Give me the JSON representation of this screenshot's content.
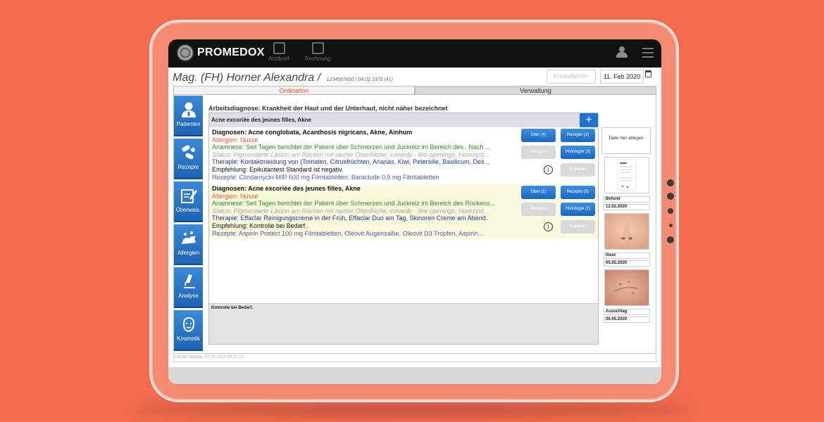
{
  "app": {
    "logo": "PROMEDOX"
  },
  "toolbar": {
    "items": [
      {
        "label": "Arztbrief",
        "icon": "edit-icon"
      },
      {
        "label": "Rechnung",
        "icon": "calculator-icon"
      }
    ]
  },
  "patient": {
    "name": "Mag. (FH) Horner Alexandra /",
    "meta": "1234567890 / 04.02.1979 (41)"
  },
  "header": {
    "kontrolltermin_label": "Kontrolltermin",
    "date": "11. Feb 2020"
  },
  "tabs": [
    {
      "label": "Ordination",
      "active": true
    },
    {
      "label": "Verwaltung",
      "active": false
    }
  ],
  "sidebar": {
    "items": [
      {
        "label": "Patienten",
        "icon": "doctor-icon"
      },
      {
        "label": "Rezepte",
        "icon": "pills-icon"
      },
      {
        "label": "Überweis.",
        "icon": "referral-icon"
      },
      {
        "label": "Allergien",
        "icon": "allergy-icon"
      },
      {
        "label": "Analyse",
        "icon": "microscope-icon"
      },
      {
        "label": "Kosmetik",
        "icon": "face-icon"
      }
    ]
  },
  "main": {
    "arbeitsdiagnose": "Arbeitsdiagnose: Krankheit der Haut und der Unterhaut, nicht näher bezeichnet",
    "panel_header": "Acne excoriée des jeunes filles, Akne",
    "add_label": "+",
    "entries": [
      {
        "diagnose": "Diagnosen: Acne conglobata, Acanthosis nigricans, Akne, Ainhum",
        "allergien": "Allergien: Nüsse",
        "anamnese": "Anamnese: Seit  Tagen berichtet der Patient über Schmerzen und Juckreiz im Bereich des  . Nach ...",
        "status": "Status: Pigmentierte Läsion am Rücken mit rauher Oberfläche, comedo - like openings, Honrzyst...",
        "therapie": "Therapie: Kontaktmeidung von (Tomaten, Citrusfrüchten, Ananas, Kiwi, Petersilie, Basilicum, Des...",
        "empfehlung": "Empfehlung: Epikutantest Standard ist negativ.",
        "rezepte": "Rezepte: Clindamycin-MIP 600 mg Filmtabletten, Baraclude 0,5 mg Filmtabletten",
        "btn_ueber": "Über (4)",
        "btn_rezepte": "Rezepte (2)",
        "btn_allergien": "Allergien",
        "btn_histologie": "Histologie (3)",
        "btn_kopieren": "Kopieren",
        "info": "i"
      },
      {
        "diagnose": "Diagnosen: Acne excoriée des jeunes filles, Akne",
        "allergien": "Allergien: Nüsse",
        "anamnese": "Anamnese: Seit  Tagen berichtet der Patient über Schmerzen und Juckreiz im Bereich des  Rückens...",
        "status": "Status: Pigmentierte Läsion am Rücken mit rauher Oberfläche, comedo - like openings, Honrzyst...",
        "therapie": "Therapie: Effaclar Reinigungscreme in der Früh, Effaclar Duo am Tag, Skinoren Creme am Abend.",
        "empfehlung": "Empfehlung: Kontrolle bei Bedarf.",
        "rezepte": "Rezepte: Aspirin Protect 100 mg Filmtabletten, Oleovit Augensalbe, Oleovit D3 Tropfen, Aspirin...",
        "btn_ueber": "Über (1)",
        "btn_rezepte": "Rezepte (5)",
        "btn_allergien": "Allergien",
        "btn_histologie": "Histologie (1)",
        "btn_kopieren": "Kopieren",
        "info": "i"
      }
    ],
    "footer_note": "Kontrolle bei Bedarf."
  },
  "files": {
    "drop_label": "Datei hier ablegen",
    "items": [
      {
        "name": "Befund",
        "date": "12.02.2020",
        "thumb": "document"
      },
      {
        "name": "Nase",
        "date": "05.05.2020",
        "thumb": "nose-photo"
      },
      {
        "name": "Ausschlag",
        "date": "06.05.2020",
        "thumb": "skin-photo"
      }
    ]
  },
  "status_bar": {
    "last_update": "Letzter Update:   07.05.2020 20:37:13"
  },
  "colors": {
    "background": "#f26b4f",
    "accent_blue": "#1e73cf",
    "tab_active": "#e05c2d",
    "allergy": "#e0572a",
    "anamnese": "#2a8a2a",
    "therapie": "#1c3c8c"
  }
}
